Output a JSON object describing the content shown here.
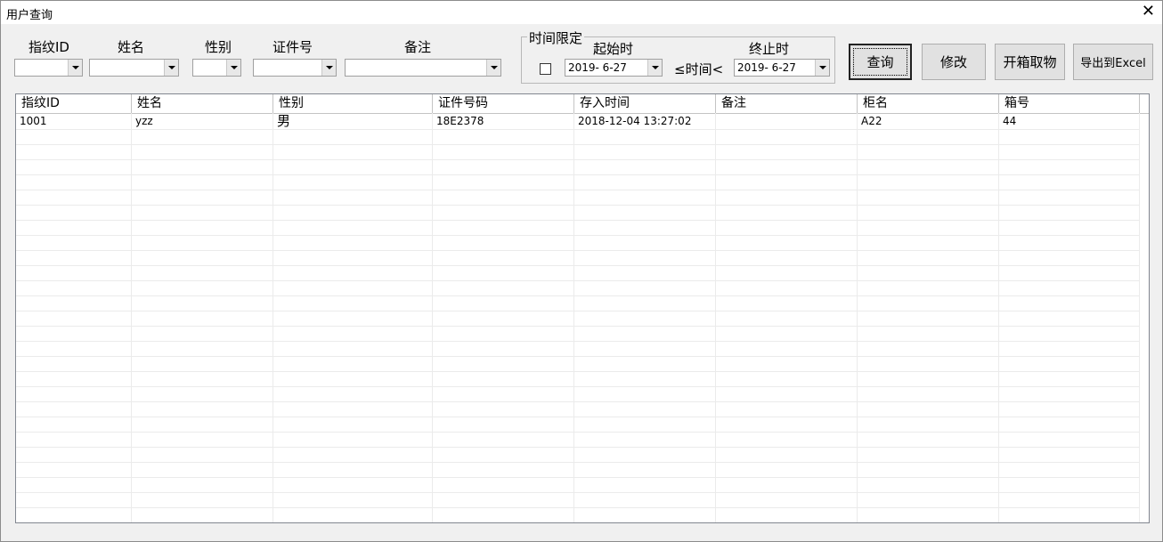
{
  "window": {
    "title": "用户查询"
  },
  "filters": {
    "fingerprint_label": "指纹ID",
    "name_label": "姓名",
    "gender_label": "性别",
    "id_label": "证件号",
    "note_label": "备注"
  },
  "time_limit": {
    "legend": "时间限定",
    "start_label": "起始时",
    "end_label": "终止时",
    "operator_label": "≤时间<",
    "start_value": "2019-  6-27",
    "end_value": "2019-  6-27",
    "enabled": false
  },
  "buttons": {
    "query": "查询",
    "modify": "修改",
    "open_box": "开箱取物",
    "export": "导出到Excel"
  },
  "table": {
    "columns": [
      "指纹ID",
      "姓名",
      "性别",
      "证件号码",
      "存入时间",
      "备注",
      "柜名",
      "箱号"
    ],
    "rows": [
      [
        "1001",
        "yzz",
        "男",
        "18E2378",
        "2018-12-04 13:27:02",
        "",
        "A22",
        "44"
      ]
    ]
  }
}
